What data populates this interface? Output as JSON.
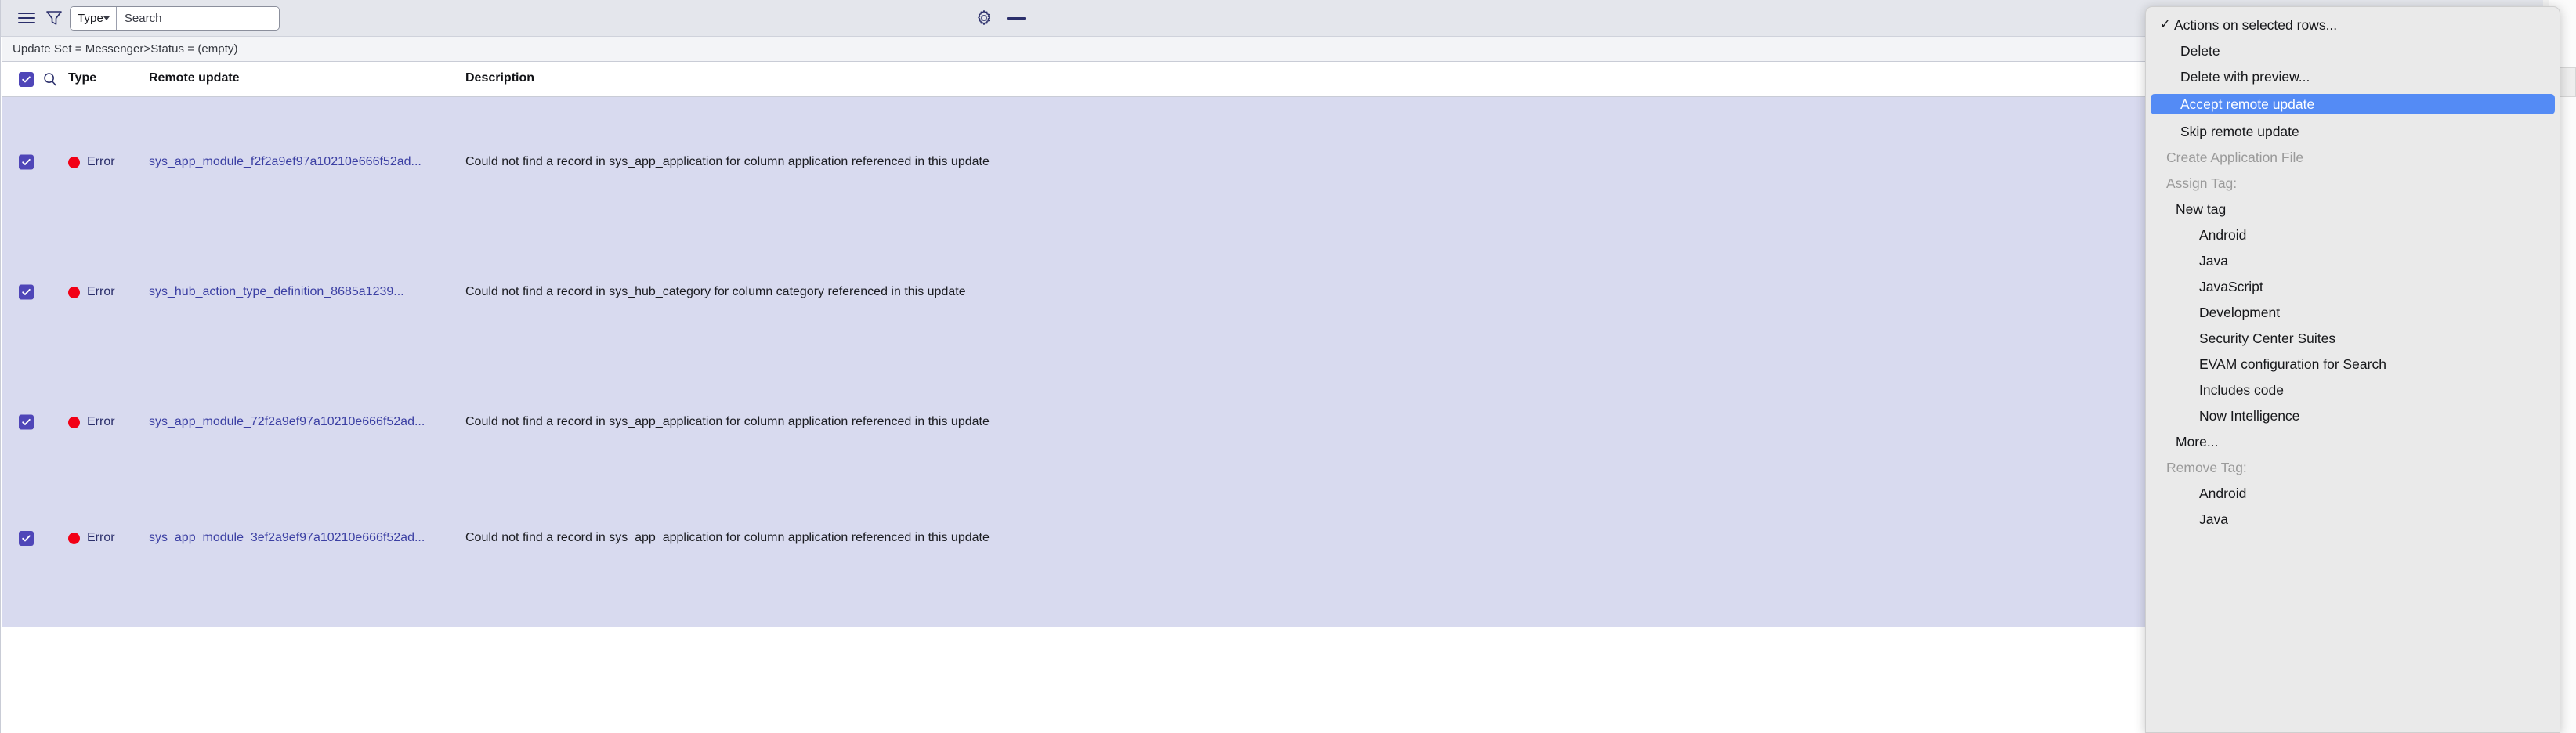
{
  "toolbar": {
    "hamburger_icon": "hamburger-menu-icon",
    "filter_icon": "filter-funnel-icon",
    "type_selector_value": "Type",
    "search_placeholder": "Search",
    "search_value": "",
    "gear_icon": "gear-icon",
    "minimize_icon": "minus-icon"
  },
  "breadcrumb": {
    "text": "Update Set = Messenger>Status = (empty)"
  },
  "table": {
    "header": {
      "select_all_checked": true,
      "search_icon": "magnifier-icon",
      "columns": [
        {
          "key": "type",
          "label": "Type"
        },
        {
          "key": "remote_update",
          "label": "Remote update"
        },
        {
          "key": "description",
          "label": "Description"
        }
      ]
    },
    "rows": [
      {
        "selected": true,
        "type": "Error",
        "status_color": "#f20016",
        "remote_update": "sys_app_module_f2f2a9ef97a10210e666f52ad...",
        "description": "Could not find a record in sys_app_application for column application referenced in this update"
      },
      {
        "selected": true,
        "type": "Error",
        "status_color": "#f20016",
        "remote_update": "sys_hub_action_type_definition_8685a1239...",
        "description": "Could not find a record in sys_hub_category for column category referenced in this update"
      },
      {
        "selected": true,
        "type": "Error",
        "status_color": "#f20016",
        "remote_update": "sys_app_module_72f2a9ef97a10210e666f52ad...",
        "description": "Could not find a record in sys_app_application for column application referenced in this update"
      },
      {
        "selected": true,
        "type": "Error",
        "status_color": "#f20016",
        "remote_update": "sys_app_module_3ef2a9ef97a10210e666f52ad...",
        "description": "Could not find a record in sys_app_application for column application referenced in this update"
      }
    ]
  },
  "action_menu": {
    "title": "Actions on selected rows...",
    "title_checked": true,
    "highlight_color": "#548bf5",
    "items": [
      {
        "label": "Actions on selected rows...",
        "kind": "title",
        "checked": true
      },
      {
        "label": "Delete",
        "kind": "item"
      },
      {
        "label": "Delete with preview...",
        "kind": "item"
      },
      {
        "label": "Accept remote update",
        "kind": "item",
        "selected": true
      },
      {
        "label": "Skip remote update",
        "kind": "item"
      },
      {
        "label": "Create Application File",
        "kind": "disabled"
      },
      {
        "label": "Assign Tag:",
        "kind": "header"
      },
      {
        "label": "New tag",
        "kind": "item"
      },
      {
        "label": "Android",
        "kind": "subitem"
      },
      {
        "label": "Java",
        "kind": "subitem"
      },
      {
        "label": "JavaScript",
        "kind": "subitem"
      },
      {
        "label": "Development",
        "kind": "subitem"
      },
      {
        "label": "Security Center Suites",
        "kind": "subitem"
      },
      {
        "label": "EVAM configuration for Search",
        "kind": "subitem"
      },
      {
        "label": "Includes code",
        "kind": "subitem"
      },
      {
        "label": "Now Intelligence",
        "kind": "subitem"
      },
      {
        "label": "More...",
        "kind": "item"
      },
      {
        "label": "Remove Tag:",
        "kind": "header"
      },
      {
        "label": "Android",
        "kind": "subitem"
      },
      {
        "label": "Java",
        "kind": "subitem"
      }
    ]
  }
}
